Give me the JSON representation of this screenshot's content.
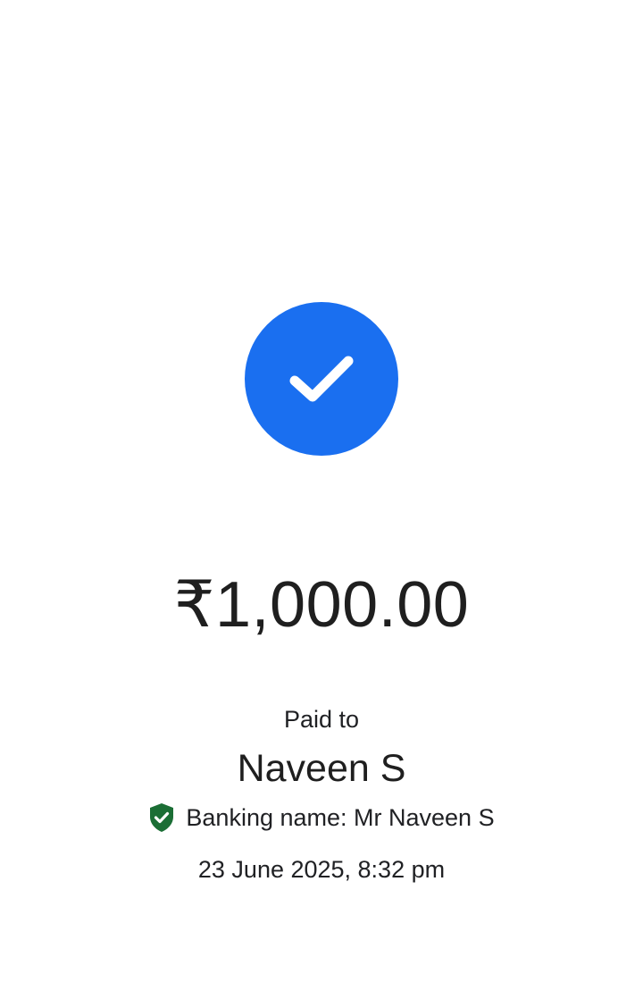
{
  "payment": {
    "status_icon": "check-icon",
    "amount": "₹1,000.00",
    "paid_to_label": "Paid to",
    "payee_name": "Naveen S",
    "verified_icon": "verified-shield-icon",
    "banking_name": "Banking name: Mr Naveen S",
    "datetime": "23 June 2025, 8:32 pm"
  },
  "colors": {
    "success_blue": "#1a6ff0",
    "verified_green": "#1b6e35",
    "text_dark": "#202124"
  }
}
